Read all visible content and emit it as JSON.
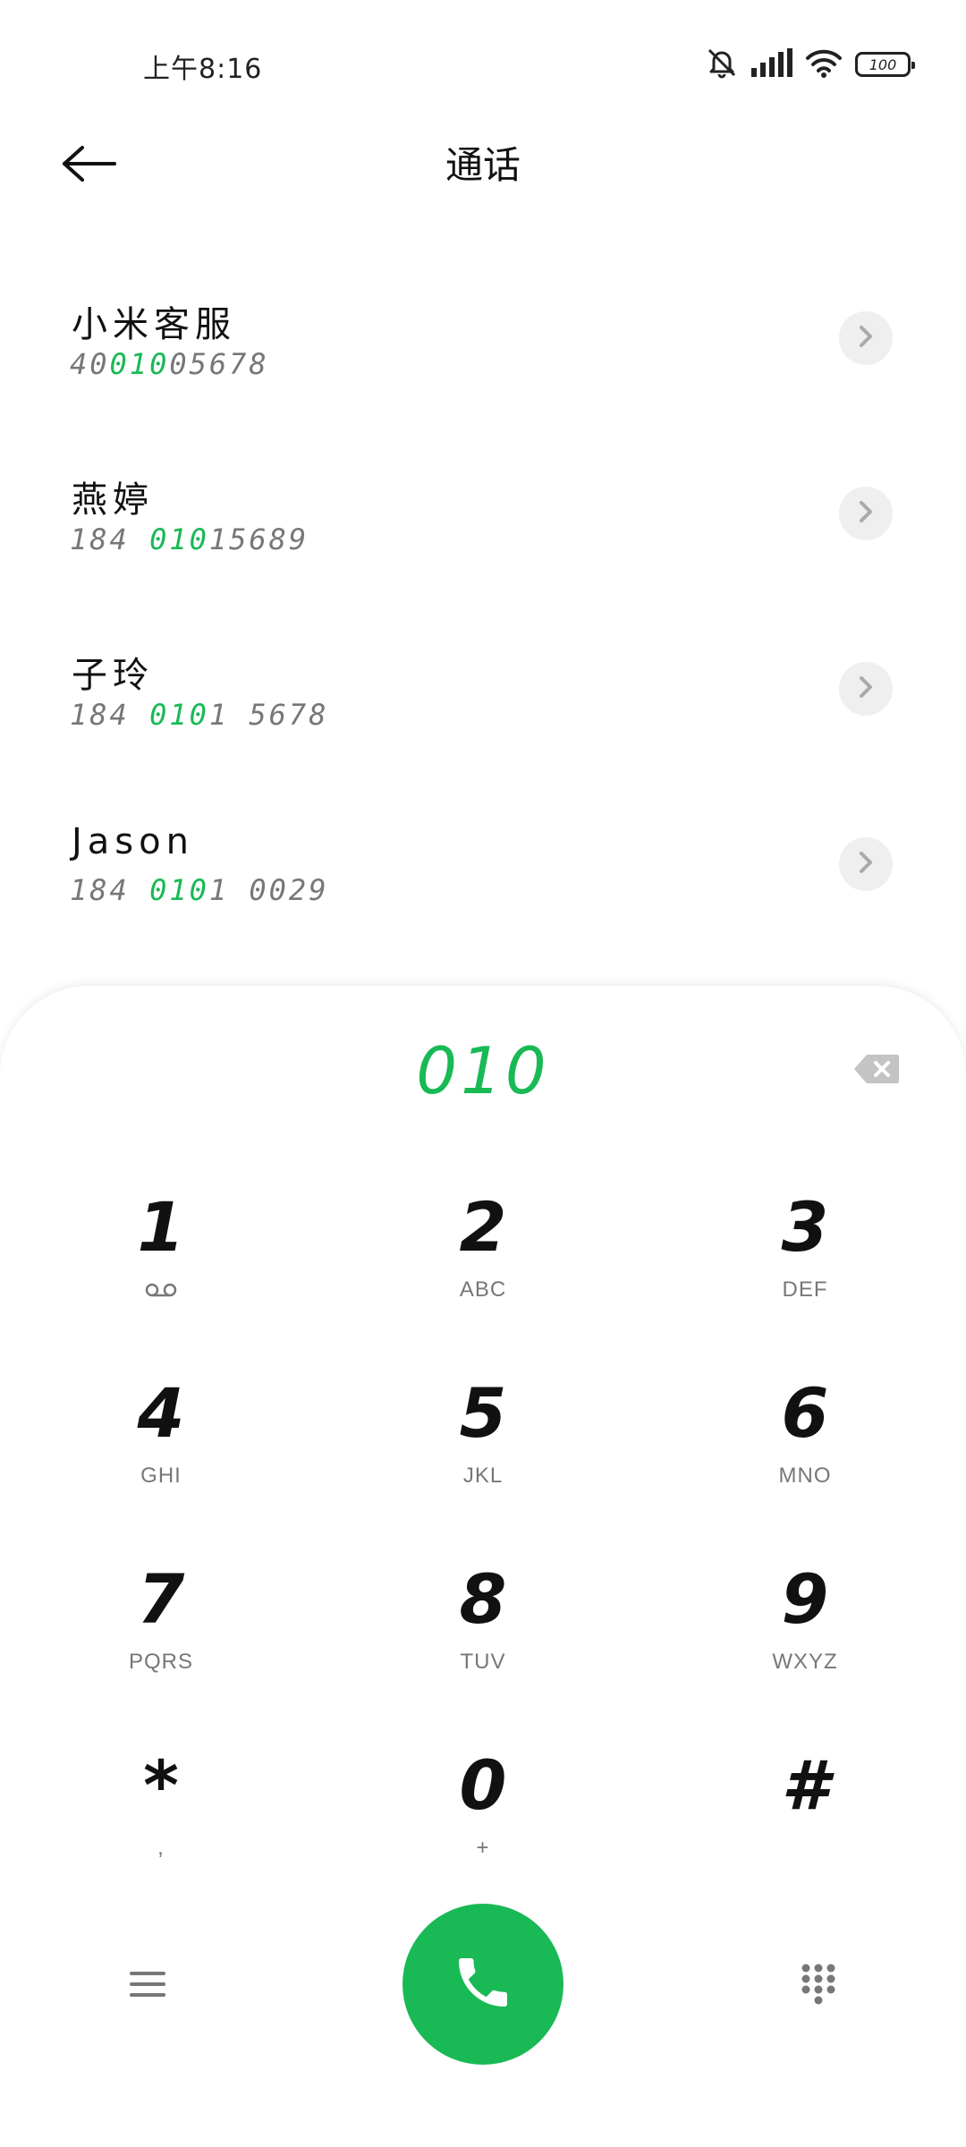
{
  "status_bar": {
    "time": "上午8:16",
    "battery": "100"
  },
  "header": {
    "title": "通话"
  },
  "contacts": [
    {
      "name": "小米客服",
      "number_parts": [
        "40",
        "010",
        "05678"
      ]
    },
    {
      "name": "燕婷",
      "number_parts": [
        "184 ",
        "010",
        "15689"
      ]
    },
    {
      "name": "子玲",
      "number_parts": [
        "184 ",
        "010",
        "1 5678"
      ]
    },
    {
      "name": "Jason",
      "number_parts": [
        "184 ",
        "010",
        "1 0029"
      ]
    }
  ],
  "dialer": {
    "input": "010",
    "keys": [
      {
        "digit": "1",
        "letters": ""
      },
      {
        "digit": "2",
        "letters": "ABC"
      },
      {
        "digit": "3",
        "letters": "DEF"
      },
      {
        "digit": "4",
        "letters": "GHI"
      },
      {
        "digit": "5",
        "letters": "JKL"
      },
      {
        "digit": "6",
        "letters": "MNO"
      },
      {
        "digit": "7",
        "letters": "PQRS"
      },
      {
        "digit": "8",
        "letters": "TUV"
      },
      {
        "digit": "9",
        "letters": "WXYZ"
      },
      {
        "digit": "*",
        "letters": ","
      },
      {
        "digit": "0",
        "letters": "+"
      },
      {
        "digit": "#",
        "letters": ""
      }
    ]
  },
  "colors": {
    "accent": "#19b955",
    "secondary_text": "#777777",
    "chip_bg": "#efefef"
  },
  "icons": {
    "back": "arrow-left-icon",
    "detail": "chevron-right-icon",
    "delete": "backspace-icon",
    "voicemail": "voicemail-icon",
    "menu": "menu-icon",
    "call": "phone-icon",
    "keypad": "dialpad-icon",
    "mute": "bell-off-icon",
    "signal": "signal-icon",
    "wifi": "wifi-icon"
  }
}
